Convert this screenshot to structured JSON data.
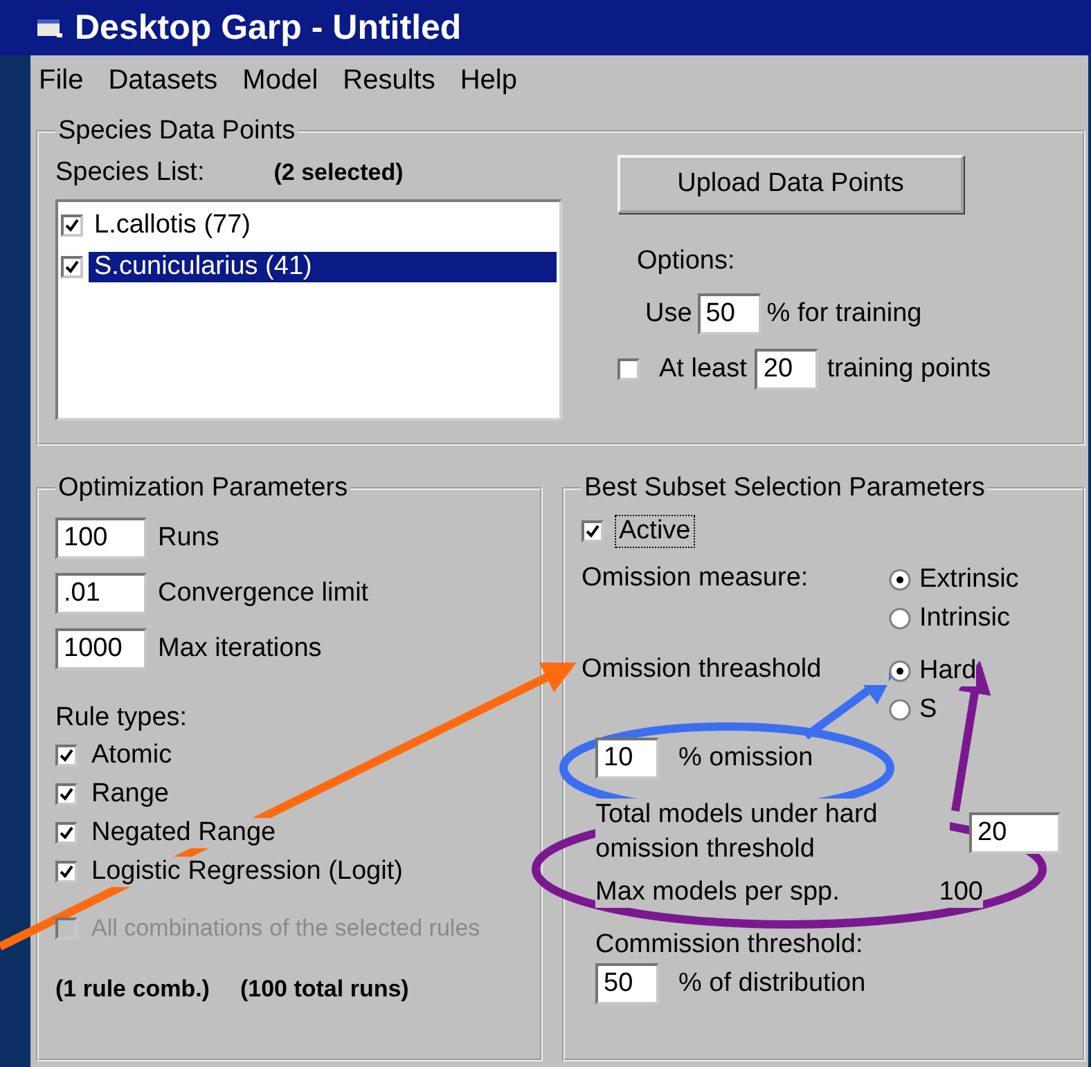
{
  "window": {
    "title": "Desktop Garp - Untitled"
  },
  "menu": [
    "File",
    "Datasets",
    "Model",
    "Results",
    "Help"
  ],
  "species": {
    "title": "Species Data Points",
    "list_label": "Species List:",
    "selected_count": "(2 selected)",
    "items": [
      {
        "label": "L.callotis (77)",
        "checked": true,
        "selected": false
      },
      {
        "label": "S.cunicularius (41)",
        "checked": true,
        "selected": true
      }
    ],
    "upload_button": "Upload Data Points",
    "options_label": "Options:",
    "use_label": "Use",
    "training_percent": "50",
    "percent_label": "% for training",
    "at_least": {
      "checked": false,
      "label": "At least",
      "value": "20",
      "suffix": "training points"
    }
  },
  "optimization": {
    "title": "Optimization Parameters",
    "fields": [
      {
        "value": "100",
        "label": "Runs"
      },
      {
        "value": ".01",
        "label": "Convergence limit"
      },
      {
        "value": "1000",
        "label": "Max iterations"
      }
    ],
    "rule_types_label": "Rule types:",
    "rules": [
      {
        "label": "Atomic",
        "checked": true,
        "disabled": false
      },
      {
        "label": "Range",
        "checked": true,
        "disabled": false
      },
      {
        "label": "Negated Range",
        "checked": true,
        "disabled": false
      },
      {
        "label": "Logistic Regression (Logit)",
        "checked": true,
        "disabled": false
      },
      {
        "label": "All combinations of the selected rules",
        "checked": false,
        "disabled": true
      }
    ],
    "summary": [
      "(1 rule comb.)",
      "(100 total runs)"
    ]
  },
  "best_subset": {
    "title": "Best Subset Selection Parameters",
    "active": {
      "label": "Active",
      "checked": true
    },
    "omission_measure": {
      "label": "Omission measure:",
      "options": [
        {
          "label": "Extrinsic",
          "selected": true
        },
        {
          "label": "Intrinsic",
          "selected": false
        }
      ]
    },
    "omission_threshold": {
      "label": "Omission threashold",
      "options": [
        {
          "label": "Hard",
          "selected": true
        },
        {
          "label": "S",
          "selected": false
        }
      ]
    },
    "omission_percent": {
      "value": "10",
      "label": "% omission"
    },
    "total_models": {
      "label": "Total models under hard omission threshold",
      "value": "20"
    },
    "max_models": {
      "label": "Max models per spp.",
      "value": "100"
    },
    "commission": {
      "label": "Commission threshold:",
      "value": "50",
      "suffix": "% of distribution"
    }
  },
  "annotations": [
    {
      "kind": "arrow",
      "color": "#ff6a10"
    },
    {
      "kind": "ellipse",
      "color": "#3c6ef0"
    },
    {
      "kind": "arrow",
      "color": "#3c6ef0"
    },
    {
      "kind": "ellipse",
      "color": "#7a1890"
    },
    {
      "kind": "arrow",
      "color": "#7a1890"
    }
  ]
}
